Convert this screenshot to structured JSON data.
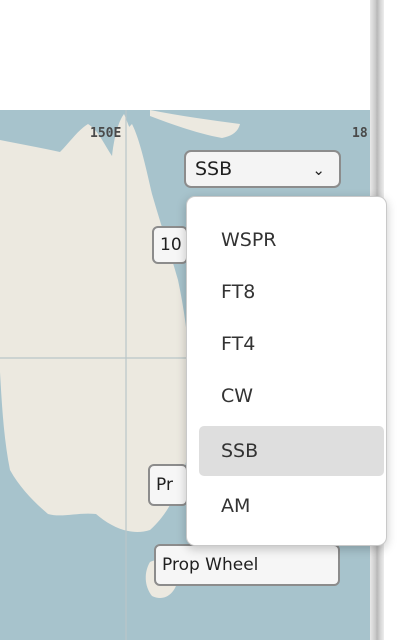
{
  "map": {
    "longitude_labels": [
      "150E",
      "18"
    ]
  },
  "mode_select": {
    "value": "SSB",
    "chevron_icon": "chevron-down-icon"
  },
  "chips": {
    "partial_top": "10",
    "partial_mid": "Pr",
    "prop_wheel": "Prop Wheel"
  },
  "dropdown": {
    "options": [
      "WSPR",
      "FT8",
      "FT4",
      "CW",
      "SSB",
      "AM"
    ],
    "selected": "SSB"
  },
  "colors": {
    "ocean": "#a7c3cc",
    "land": "#ece9e0",
    "selected_option": "#dedede"
  }
}
